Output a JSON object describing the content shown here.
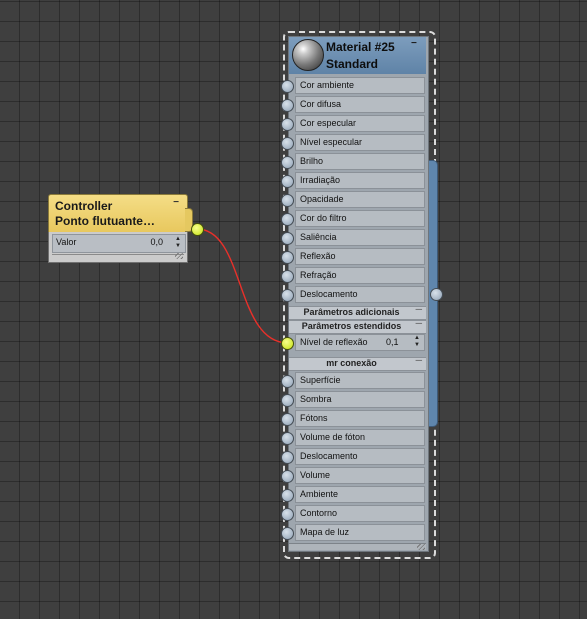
{
  "controller_node": {
    "title_line1": "Controller",
    "title_line2": "Ponto  flutuante…",
    "minimize": "−",
    "param_label": "Valor",
    "param_value": "0,0",
    "spinner_icon": "updown-spinner"
  },
  "material_node": {
    "title_line1": "Material #25",
    "title_line2": "Standard",
    "minimize": "−",
    "slots": [
      "Cor ambiente",
      "Cor difusa",
      "Cor especular",
      "Nível especular",
      "Brilho",
      "Irradiação",
      "Opacidade",
      "Cor do filtro",
      "Saliência",
      "Reflexão",
      "Refração",
      "Deslocamento"
    ],
    "section_additional": "Parâmetros adicionais",
    "section_extended": "Parâmetros estendidos",
    "extended_param_label": "Nível de reflexão",
    "extended_param_value": "0,1",
    "section_mr": "mr conexão",
    "mr_slots": [
      "Superfície",
      "Sombra",
      "Fótons",
      "Volume de fóton",
      "Deslocamento",
      "Volume",
      "Ambiente",
      "Contorno",
      "Mapa de luz"
    ]
  },
  "colors": {
    "background": "#3f3f3f",
    "controller_header": "#e8c85e",
    "material_header": "#6b8eb2",
    "wire": "#e8302a",
    "connected_port": "#d8f020",
    "port": "#a9b6c4"
  }
}
